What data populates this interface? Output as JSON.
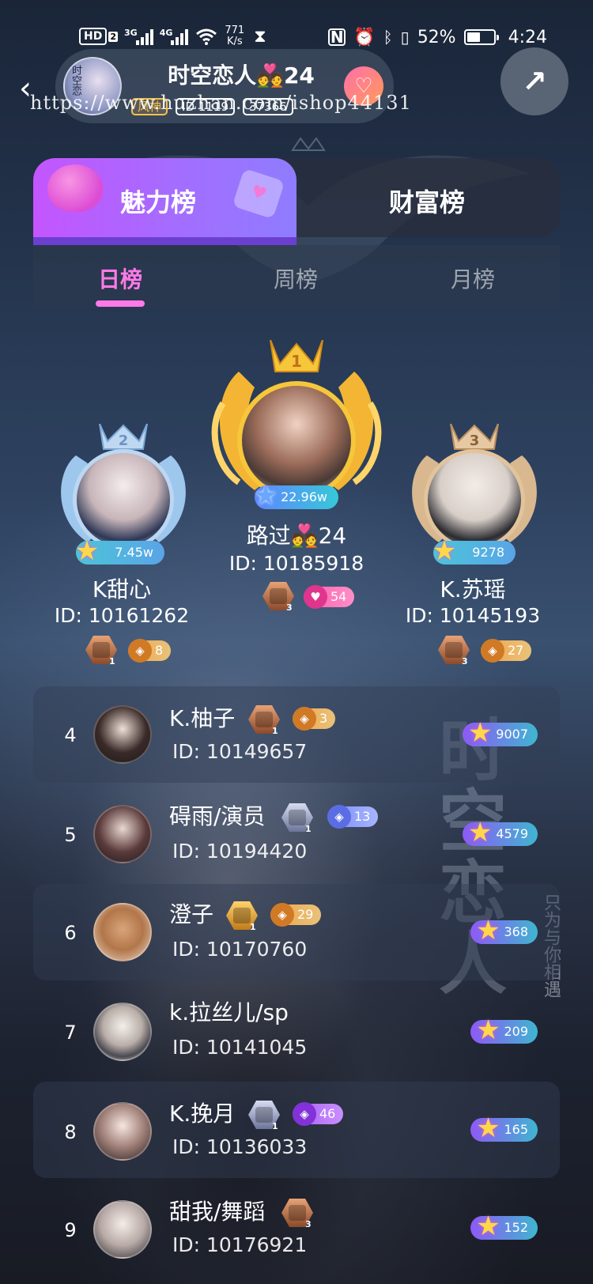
{
  "status_bar": {
    "hd": "HD",
    "hd_sub": "2",
    "sig1": "3G",
    "sig2": "4G",
    "net_speed": "771",
    "net_unit": "K/s",
    "battery_pct": "52%",
    "battery_level": 0.52,
    "time": "4:24"
  },
  "header": {
    "room_avatar_text": "时空恋",
    "room_title": "时空恋人💑24",
    "badges": [
      "风神",
      "ID 1119",
      "37366"
    ],
    "watermark": "https://www.huzhan.com/ishop44131"
  },
  "icons": {
    "back": "back-chevron-icon",
    "share": "share-icon",
    "follow": "heart-plus-icon"
  },
  "main_tabs": [
    "魅力榜",
    "财富榜"
  ],
  "sub_tabs": [
    "日榜",
    "周榜",
    "月榜"
  ],
  "podium": [
    {
      "rank": "1",
      "name": "路过💑24",
      "id": "ID: 10185918",
      "score": "22.96w",
      "level_badge_sub": "3",
      "fan_value": "54",
      "fan_color": "pink"
    },
    {
      "rank": "2",
      "name": "K甜心",
      "id": "ID: 10161262",
      "score": "7.45w",
      "level_badge_sub": "1",
      "fan_value": "8",
      "fan_color": "orange"
    },
    {
      "rank": "3",
      "name": "K.苏瑶",
      "id": "ID: 10145193",
      "score": "9278",
      "level_badge_sub": "3",
      "fan_value": "27",
      "fan_color": "orange"
    }
  ],
  "list": [
    {
      "rank": "4",
      "name": "K.柚子",
      "id": "ID: 10149657",
      "score": "9007",
      "badge": "bronze",
      "badge_sub": "1",
      "fan_value": "3",
      "fan_color": "orange"
    },
    {
      "rank": "5",
      "name": "碍雨/演员",
      "id": "ID: 10194420",
      "score": "4579",
      "badge": "silver",
      "badge_sub": "1",
      "fan_value": "13",
      "fan_color": "blue"
    },
    {
      "rank": "6",
      "name": "澄子",
      "id": "ID: 10170760",
      "score": "368",
      "badge": "gold",
      "badge_sub": "1",
      "fan_value": "29",
      "fan_color": "orange"
    },
    {
      "rank": "7",
      "name": "k.拉丝儿/sp",
      "id": "ID: 10141045",
      "score": "209"
    },
    {
      "rank": "8",
      "name": "K.挽月",
      "id": "ID: 10136033",
      "score": "165",
      "badge": "silver",
      "badge_sub": "1",
      "fan_value": "46",
      "fan_color": "purple"
    },
    {
      "rank": "9",
      "name": "甜我/舞蹈",
      "id": "ID: 10176921",
      "score": "152",
      "badge": "bronze",
      "badge_sub": "3"
    }
  ],
  "background_text": {
    "title": "时空恋人",
    "slogan": "只为与你相遇"
  }
}
